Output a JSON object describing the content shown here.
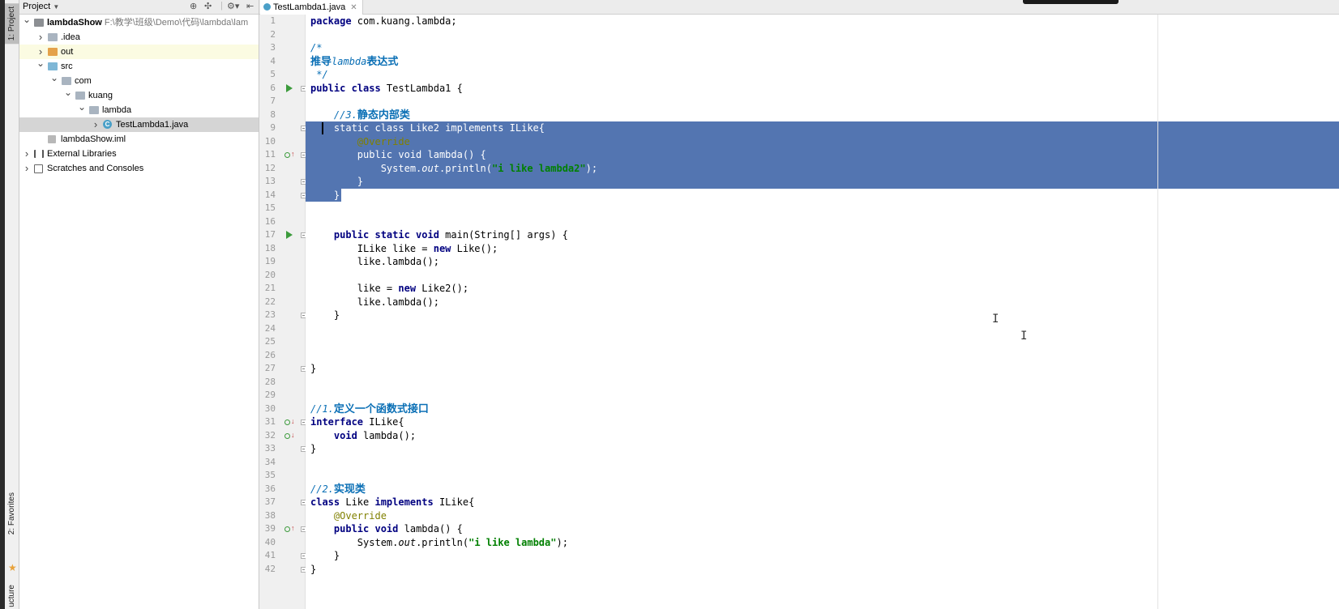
{
  "left_toolstrip": {
    "project_tab": "1: Project",
    "favorites_tab": "2: Favorites",
    "structure_tab": "ucture"
  },
  "project_panel": {
    "title": "Project",
    "tree": [
      {
        "label": "lambdaShow",
        "path": "F:\\教学\\班级\\Demo\\代码\\lambda\\lam",
        "depth": 0,
        "expanded": true,
        "icon": "module-icon"
      },
      {
        "label": ".idea",
        "depth": 1,
        "expanded": false,
        "icon": "folder-icon"
      },
      {
        "label": "out",
        "depth": 1,
        "expanded": false,
        "icon": "folder-orange-icon",
        "highlight": true
      },
      {
        "label": "src",
        "depth": 1,
        "expanded": true,
        "icon": "source-folder-icon"
      },
      {
        "label": "com",
        "depth": 2,
        "expanded": true,
        "icon": "package-icon"
      },
      {
        "label": "kuang",
        "depth": 3,
        "expanded": true,
        "icon": "package-icon"
      },
      {
        "label": "lambda",
        "depth": 4,
        "expanded": true,
        "icon": "package-icon"
      },
      {
        "label": "TestLambda1.java",
        "depth": 5,
        "expanded": false,
        "icon": "java-class-icon",
        "selected": true
      },
      {
        "label": "lambdaShow.iml",
        "depth": 1,
        "expanded": null,
        "icon": "iml-file-icon"
      },
      {
        "label": "External Libraries",
        "depth": 0,
        "expanded": false,
        "icon": "libraries-icon"
      },
      {
        "label": "Scratches and Consoles",
        "depth": 0,
        "expanded": false,
        "icon": "scratches-icon"
      }
    ]
  },
  "editor": {
    "tab_label": "TestLambda1.java",
    "lines": [
      {
        "n": "1",
        "html": "<span class='kw'>package</span> com.kuang.lambda;"
      },
      {
        "n": "2",
        "html": ""
      },
      {
        "n": "3",
        "html": "<span class='cmz'>/*</span>"
      },
      {
        "n": "4",
        "html": "<span class='cmzh'>推导</span><span class='cmz'>lambda</span><span class='cmzh'>表达式</span>"
      },
      {
        "n": "5",
        "html": "<span class='cmz'> */</span>"
      },
      {
        "n": "6",
        "html": "<span class='kw'>public class</span> TestLambda1 {"
      },
      {
        "n": "7",
        "html": ""
      },
      {
        "n": "8",
        "html": "    <span class='cmz'>//3.</span><span class='cmzh'>静态内部类</span>"
      },
      {
        "n": "9",
        "html": "    <span class='kw'>static class</span> Like2 <span class='kw'>implements</span> ILike{",
        "sel": true
      },
      {
        "n": "10",
        "html": "        <span class='an'>@Override</span>",
        "sel": true
      },
      {
        "n": "11",
        "html": "        <span class='kw'>public void</span> lambda() {",
        "sel": true
      },
      {
        "n": "12",
        "html": "            System.<span class='it'>out</span>.println(<span class='st'>\"i like lambda2\"</span>);",
        "sel": true
      },
      {
        "n": "13",
        "html": "        }",
        "sel": true
      },
      {
        "n": "14",
        "html": "    }",
        "sel": "partial"
      },
      {
        "n": "15",
        "html": ""
      },
      {
        "n": "16",
        "html": ""
      },
      {
        "n": "17",
        "html": "    <span class='kw'>public static void</span> main(String[] args) {"
      },
      {
        "n": "18",
        "html": "        ILike like = <span class='kw'>new</span> Like();"
      },
      {
        "n": "19",
        "html": "        like.lambda();"
      },
      {
        "n": "20",
        "html": ""
      },
      {
        "n": "21",
        "html": "        like = <span class='kw'>new</span> Like2();"
      },
      {
        "n": "22",
        "html": "        like.lambda();"
      },
      {
        "n": "23",
        "html": "    }"
      },
      {
        "n": "24",
        "html": ""
      },
      {
        "n": "25",
        "html": ""
      },
      {
        "n": "26",
        "html": ""
      },
      {
        "n": "27",
        "html": "}"
      },
      {
        "n": "28",
        "html": ""
      },
      {
        "n": "29",
        "html": ""
      },
      {
        "n": "30",
        "html": "<span class='cmz'>//1.</span><span class='cmzh'>定义一个函数式接口</span>"
      },
      {
        "n": "31",
        "html": "<span class='kw'>interface</span> ILike{"
      },
      {
        "n": "32",
        "html": "    <span class='kw'>void</span> lambda();"
      },
      {
        "n": "33",
        "html": "}"
      },
      {
        "n": "34",
        "html": ""
      },
      {
        "n": "35",
        "html": ""
      },
      {
        "n": "36",
        "html": "<span class='cmz'>//2.</span><span class='cmzh'>实现类</span>"
      },
      {
        "n": "37",
        "html": "<span class='kw'>class</span> Like <span class='kw'>implements</span> ILike{"
      },
      {
        "n": "38",
        "html": "    <span class='an'>@Override</span>"
      },
      {
        "n": "39",
        "html": "    <span class='kw'>public void</span> lambda() {"
      },
      {
        "n": "40",
        "html": "        System.<span class='it'>out</span>.println(<span class='st'>\"i like lambda\"</span>);"
      },
      {
        "n": "41",
        "html": "    }"
      },
      {
        "n": "42",
        "html": "}"
      }
    ],
    "run_markers": [
      "6",
      "17"
    ],
    "override_markers": [
      "11",
      "39"
    ],
    "implemented_markers": [
      "31",
      "32"
    ],
    "fold_markers": [
      "6",
      "9",
      "11",
      "13",
      "14",
      "17",
      "23",
      "27",
      "31",
      "33",
      "37",
      "39",
      "41",
      "42"
    ]
  },
  "colors": {
    "selection": "#5375b1",
    "keyword": "#000080",
    "comment": "#0a6fb5",
    "string": "#008000",
    "annotation": "#808000"
  }
}
